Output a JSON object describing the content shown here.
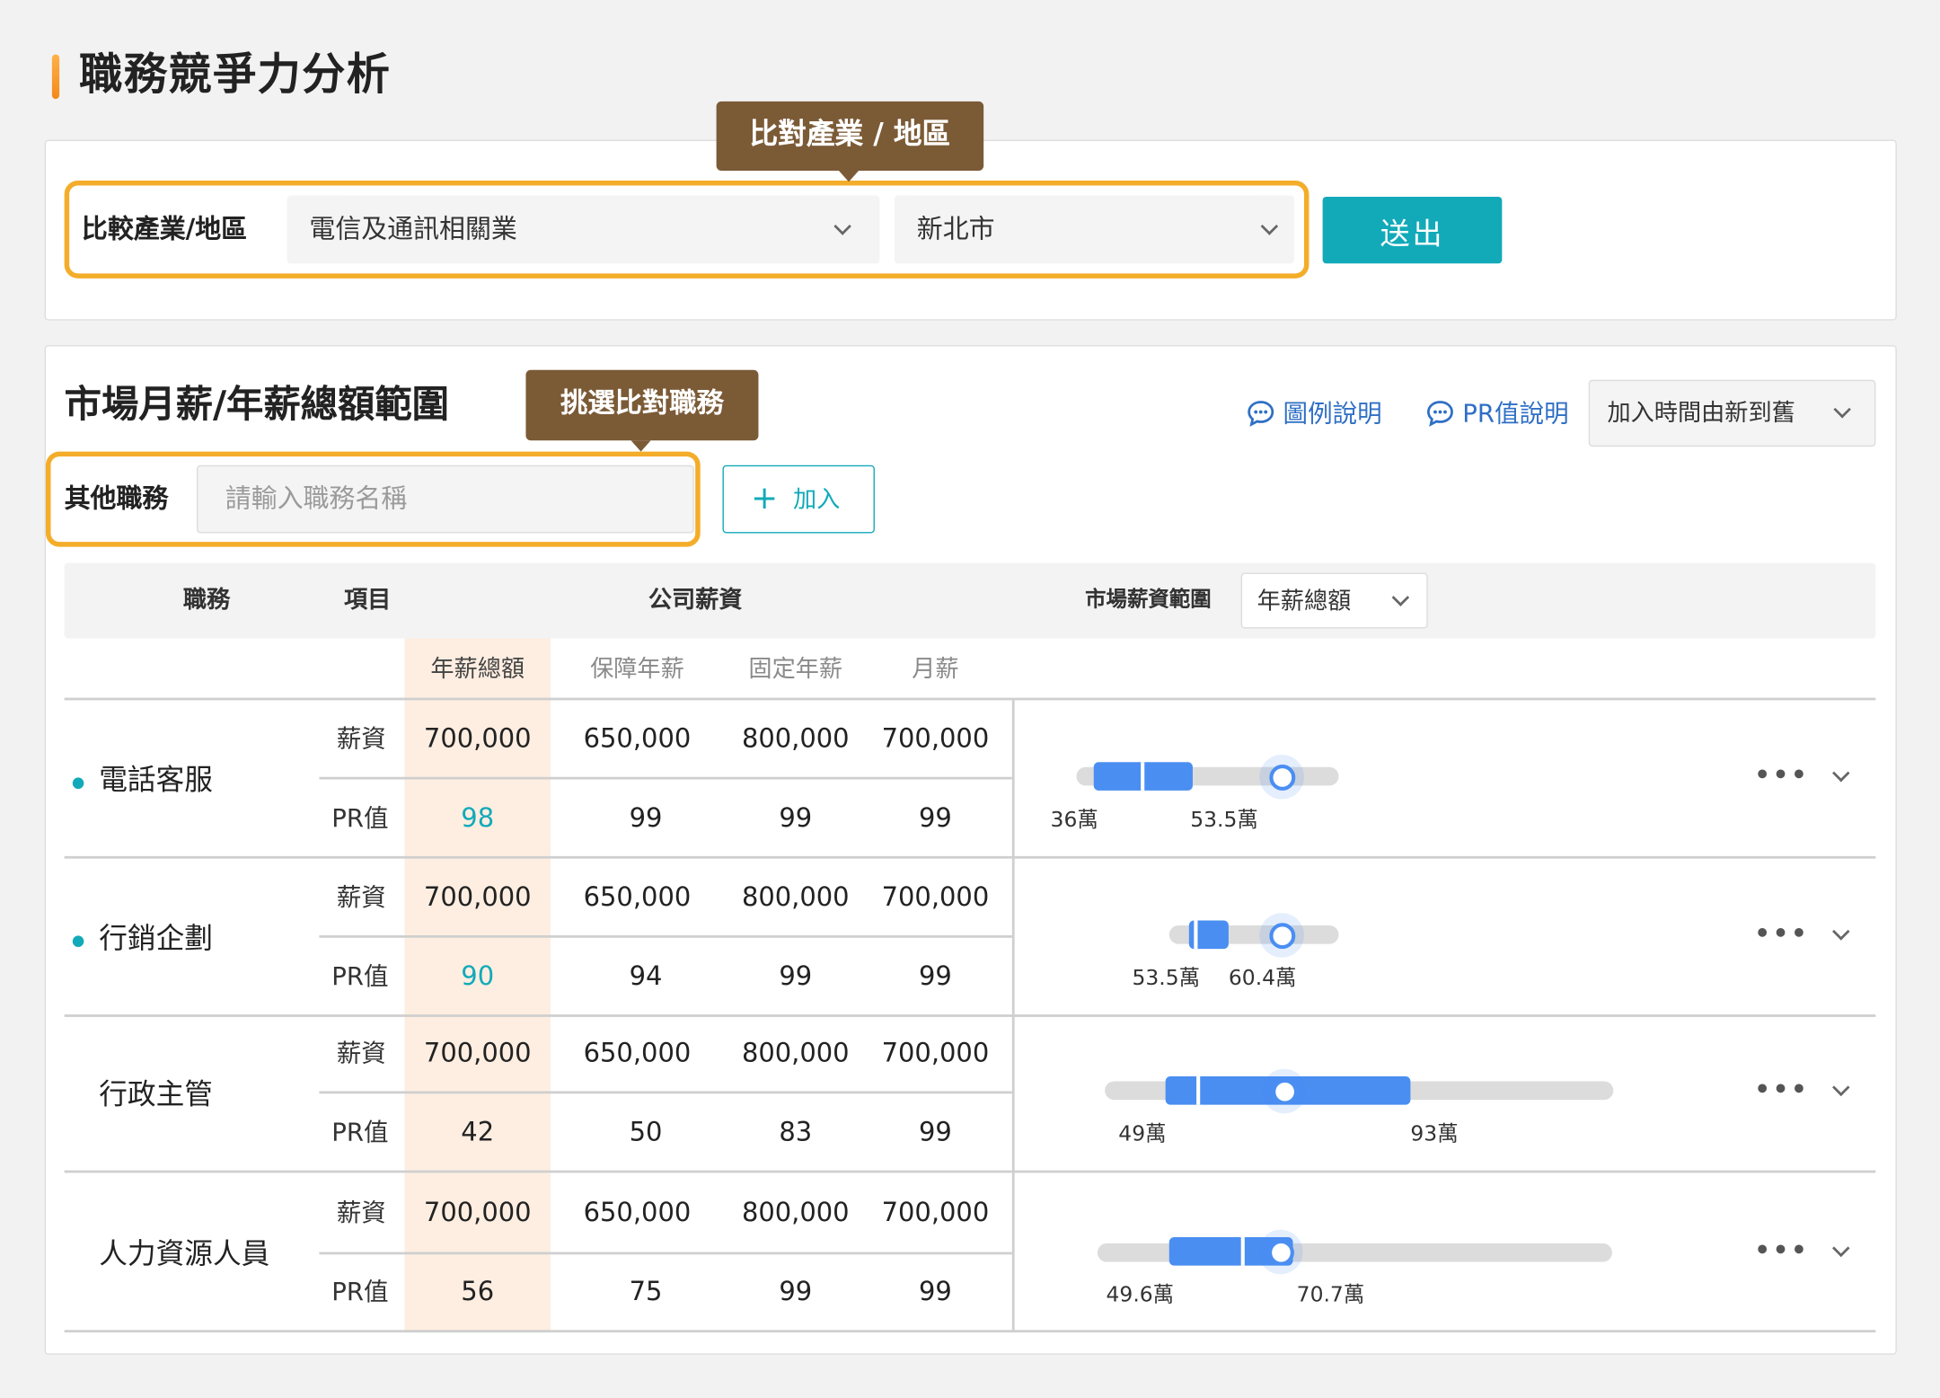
{
  "page": {
    "title": "職務競爭力分析"
  },
  "compare": {
    "tooltip": "比對產業 / 地區",
    "label": "比較產業/地區",
    "industry": "電信及通訊相關業",
    "region": "新北市",
    "submit": "送出"
  },
  "market": {
    "title": "市場月薪/年薪總額範圍",
    "tooltip": "挑選比對職務",
    "legend_help": "圖例說明",
    "pr_help": "PR值說明",
    "sort": "加入時間由新到舊",
    "other_label": "其他職務",
    "other_placeholder": "請輸入職務名稱",
    "add": "加入"
  },
  "table": {
    "headers": {
      "job": "職務",
      "item": "項目",
      "company_salary": "公司薪資",
      "market_range": "市場薪資範圍",
      "range_select": "年薪總額"
    },
    "subheaders": [
      "年薪總額",
      "保障年薪",
      "固定年薪",
      "月薪"
    ],
    "row_labels": {
      "salary": "薪資",
      "pr": "PR值"
    },
    "rows": [
      {
        "job": "電話客服",
        "dot": true,
        "salary": [
          "700,000",
          "650,000",
          "800,000",
          "700,000"
        ],
        "pr": [
          "98",
          "99",
          "99",
          "99"
        ],
        "low": "36萬",
        "high": "53.5萬"
      },
      {
        "job": "行銷企劃",
        "dot": true,
        "salary": [
          "700,000",
          "650,000",
          "800,000",
          "700,000"
        ],
        "pr": [
          "90",
          "94",
          "99",
          "99"
        ],
        "low": "53.5萬",
        "high": "60.4萬"
      },
      {
        "job": "行政主管",
        "dot": false,
        "salary": [
          "700,000",
          "650,000",
          "800,000",
          "700,000"
        ],
        "pr": [
          "42",
          "50",
          "83",
          "99"
        ],
        "low": "49萬",
        "high": "93萬"
      },
      {
        "job": "人力資源人員",
        "dot": false,
        "salary": [
          "700,000",
          "650,000",
          "800,000",
          "700,000"
        ],
        "pr": [
          "56",
          "75",
          "99",
          "99"
        ],
        "low": "49.6萬",
        "high": "70.7萬"
      }
    ]
  },
  "colors": {
    "accent": "#12aab9",
    "highlight": "#f4ad2a",
    "tooltip": "#7b5a36",
    "bar": "#4a8ef2",
    "col_highlight": "#fdeee1"
  }
}
